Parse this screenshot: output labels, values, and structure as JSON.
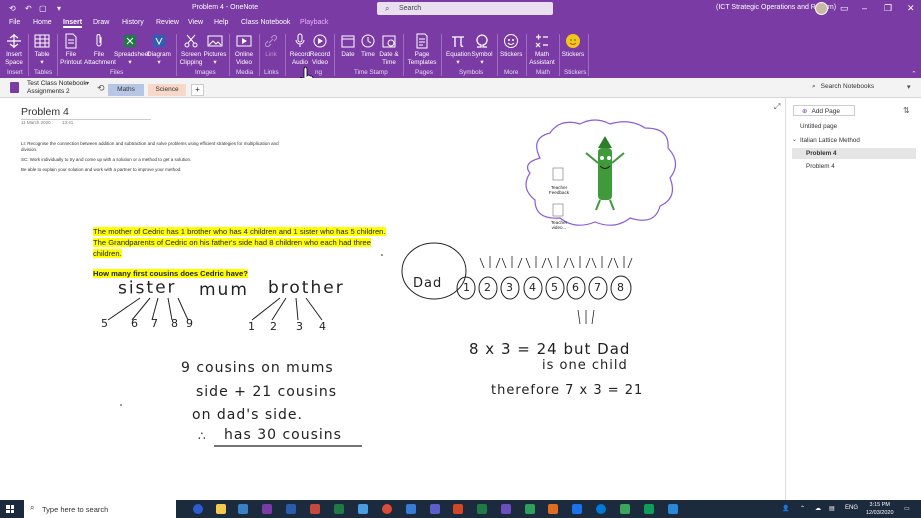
{
  "titlebar": {
    "title": "Problem 4  -  OneNote",
    "search_placeholder": "Search",
    "account": "(ICT Strategic Operations and Reform)"
  },
  "tabs": [
    "File",
    "Home",
    "Insert",
    "Draw",
    "History",
    "Review",
    "View",
    "Help",
    "Class Notebook",
    "Playback"
  ],
  "active_tab": "Insert",
  "ribbon": {
    "buttons": {
      "insert_space": "Insert Space",
      "table": "Table",
      "file_printout": "File Printout",
      "file_attachment": "File Attachment",
      "spreadsheet": "Spreadsheet",
      "diagram": "Diagram",
      "screen_clipping": "Screen Clipping",
      "pictures": "Pictures",
      "online_video": "Online Video",
      "link": "Link",
      "record_audio": "Record Audio",
      "record_video": "Record Video",
      "date": "Date",
      "time": "Time",
      "date_time": "Date & Time",
      "page_templates": "Page Templates",
      "equation": "Equation",
      "symbol": "Symbol",
      "stickers_more": "Stickers",
      "math_assistant": "Math Assistant",
      "stickers": "Stickers"
    },
    "groups": {
      "insert": "Insert",
      "tables": "Tables",
      "files": "Files",
      "images": "Images",
      "media": "Media",
      "links": "Links",
      "recording": "ng",
      "time_stamp": "Time Stamp",
      "pages": "Pages",
      "symbols": "Symbols",
      "more": "More",
      "math": "Math",
      "stickers": "Stickers"
    }
  },
  "notebook": {
    "name": "Test Class Notebook",
    "section": "Assignments 2",
    "section_tabs": [
      "Maths",
      "Science"
    ],
    "add_section": "+"
  },
  "search_notebooks": "Search Notebooks",
  "page": {
    "title": "Problem 4",
    "date": "11 March 2020",
    "time": "13:41",
    "li1": "LI: Recognise the connection between addition and subtraction and solve problems using efficient strategies for multiplication and division.",
    "sc1": "SC: Work individually to try and come up with a solution or a method to get a solution.",
    "sc2": "Be able to explain your solution and work with a partner to improve your method.",
    "problem_line1": "The mother of Cedric has 1 brother who has 4 children and 1 sister who has 5 children.",
    "problem_line2": "The Grandparents of Cedric on his father's side had 8 children who each had three",
    "problem_line3": "children.",
    "question": "How many first cousins does Cedric have?"
  },
  "handwriting": {
    "sister": "sister",
    "mum": "mum",
    "brother": "brother",
    "sister_nums": [
      "5",
      "6",
      "7",
      "8",
      "9"
    ],
    "brother_nums": [
      "1",
      "2",
      "3",
      "4"
    ],
    "dad": "Dad",
    "dad_nums": [
      "1",
      "2",
      "3",
      "4",
      "5",
      "6",
      "7",
      "8"
    ],
    "eq1": "8 x 3 = 24  but Dad",
    "eq2": "is one child",
    "eq3": "therefore  7 x 3 = 21",
    "c1": "9  cousins on mums",
    "c2": "side  +  21 cousins",
    "c3": "on dad's side.",
    "c4": "has 30 cousins",
    "therefore": "∴"
  },
  "thought_bubble": {
    "feedback": "Teacher Feedback",
    "video": "Teacher video..."
  },
  "right_pane": {
    "add_page": "Add Page",
    "pages": [
      "Untitled page",
      "Italian Lattice Method",
      "Problem 4",
      "Problem 4"
    ],
    "selected_index": 2
  },
  "taskbar": {
    "search_placeholder": "Type here to search",
    "lang": "ENG",
    "time": "3:15 PM",
    "date": "12/03/2020"
  },
  "colors": {
    "ribbon": "#7B3BA4",
    "highlight": "#ffff00",
    "taskbar": "#1c2a3e"
  }
}
